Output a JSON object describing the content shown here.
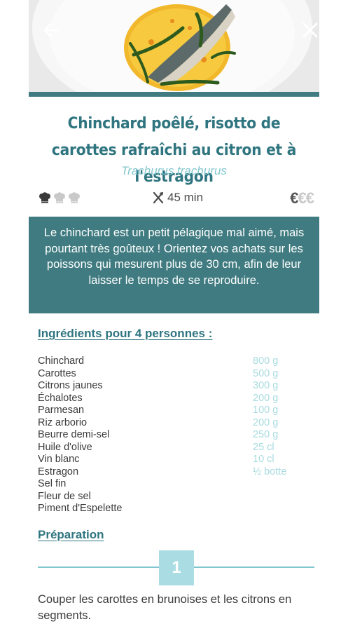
{
  "recipe": {
    "title": "Chinchard poêlé, risotto de carottes rafraîchi au citron et à l'estragon",
    "latin_name": "Trachurus trachurus",
    "difficulty_level": 1,
    "difficulty_max": 3,
    "duration_label": "45 min",
    "price_level": 1,
    "price_max": 3,
    "price_symbol": "€",
    "intro": "Le chinchard est un petit pélagique mal aimé, mais pourtant très goûteux ! Orientez vos achats sur les poissons qui mesurent plus de 30 cm, afin de leur laisser le temps de se reproduire."
  },
  "ingredients": {
    "heading": "Ingrédients pour 4 personnes :",
    "items": [
      {
        "name": "Chinchard",
        "qty": "800 g"
      },
      {
        "name": "Carottes",
        "qty": "500 g"
      },
      {
        "name": "Citrons jaunes",
        "qty": "300 g"
      },
      {
        "name": "Échalotes",
        "qty": "200 g"
      },
      {
        "name": "Parmesan",
        "qty": "100 g"
      },
      {
        "name": "Riz arborio",
        "qty": "200 g"
      },
      {
        "name": "Beurre demi-sel",
        "qty": "250 g"
      },
      {
        "name": "Huile d'olive",
        "qty": "25 cl"
      },
      {
        "name": "Vin blanc",
        "qty": "10 cl"
      },
      {
        "name": "Estragon",
        "qty": "½ botte"
      },
      {
        "name": "Sel fin",
        "qty": ""
      },
      {
        "name": "Fleur de sel",
        "qty": ""
      },
      {
        "name": "Piment d'Espelette",
        "qty": ""
      }
    ]
  },
  "preparation": {
    "heading": "Préparation",
    "steps": [
      {
        "number": "1",
        "text": "Couper les carottes en brunoises et les citrons en segments."
      }
    ]
  },
  "colors": {
    "accent": "#3f7b80",
    "title": "#2f7580",
    "light_accent": "#a9dde3",
    "quantity": "#a9dbe0"
  },
  "icons": {
    "back": "arrow-left-icon",
    "close": "close-icon",
    "difficulty": "chef-hat-icon",
    "duration": "utensils-icon"
  }
}
